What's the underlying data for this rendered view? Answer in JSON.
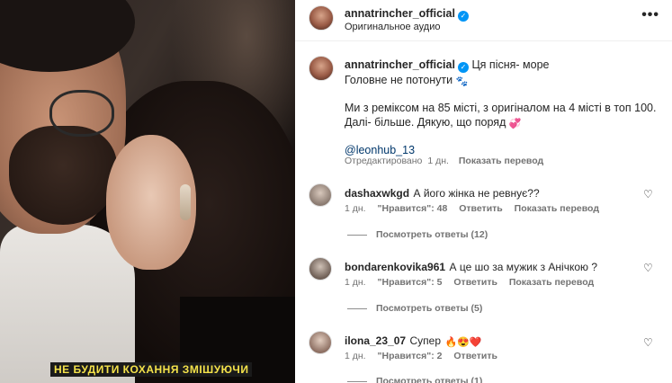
{
  "media": {
    "caption": "НЕ БУДИТИ КОХАННЯ ЗМІШУЮЧИ"
  },
  "header": {
    "username": "annatrincher_official",
    "audio": "Оригинальное аудио",
    "more_icon": "•••"
  },
  "post": {
    "username": "annatrincher_official",
    "line1": "Ця пісня- море",
    "line2": "Головне не потонути",
    "line2_emoji": "🐾",
    "line3": "Ми з реміксом на 85 місті, з оригіналом на 4 місті в топ 100.",
    "line4": "Далі- більше. Дякую, що поряд",
    "line4_emoji": "💞",
    "mention": "@leonhub_13",
    "edited": "Отредактировано",
    "time": "1 дн.",
    "translate": "Показать перевод"
  },
  "comments": [
    {
      "username": "dashaxwkgd",
      "text": "А його жінка не ревнує??",
      "time": "1 дн.",
      "likes": "\"Нравится\": 48",
      "reply": "Ответить",
      "translate": "Показать перевод",
      "replies": "Посмотреть ответы (12)"
    },
    {
      "username": "bondarenkovika961",
      "text": "А це шо за мужик з Анічкою ?",
      "time": "1 дн.",
      "likes": "\"Нравится\": 5",
      "reply": "Ответить",
      "translate": "Показать перевод",
      "replies": "Посмотреть ответы (5)"
    },
    {
      "username": "ilona_23_07",
      "text": "Супер",
      "emojis": "🔥😍❤️",
      "time": "1 дн.",
      "likes": "\"Нравится\": 2",
      "reply": "Ответить",
      "replies": "Посмотреть ответы (1)"
    }
  ],
  "icons": {
    "heart": "♡",
    "verified": "✓"
  },
  "colors": {
    "verified": "#0095f6",
    "caption_text": "#f4e24a",
    "meta": "#737373"
  }
}
